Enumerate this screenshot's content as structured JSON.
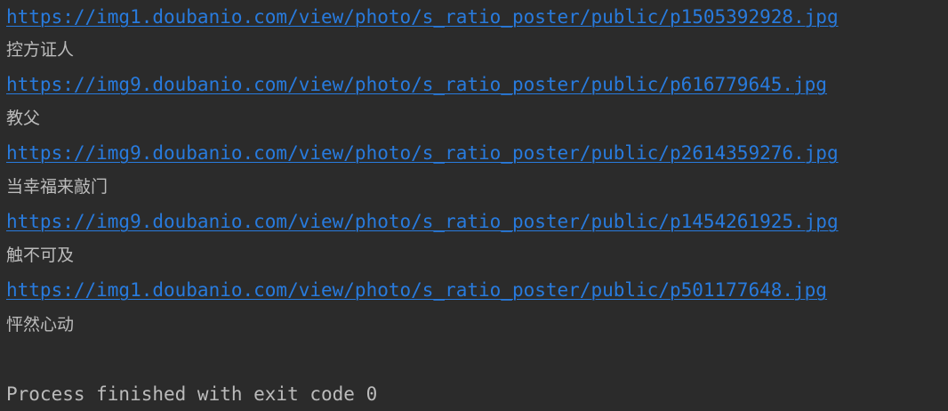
{
  "console": {
    "entries": [
      {
        "url": "https://img1.doubanio.com/view/photo/s_ratio_poster/public/p1505392928.jpg",
        "title": "控方证人"
      },
      {
        "url": "https://img9.doubanio.com/view/photo/s_ratio_poster/public/p616779645.jpg",
        "title": "教父"
      },
      {
        "url": "https://img9.doubanio.com/view/photo/s_ratio_poster/public/p2614359276.jpg",
        "title": "当幸福来敲门"
      },
      {
        "url": "https://img9.doubanio.com/view/photo/s_ratio_poster/public/p1454261925.jpg",
        "title": "触不可及"
      },
      {
        "url": "https://img1.doubanio.com/view/photo/s_ratio_poster/public/p501177648.jpg",
        "title": "怦然心动"
      }
    ],
    "exit_message": "Process finished with exit code 0"
  },
  "colors": {
    "background": "#2b2b2b",
    "link": "#287bde",
    "text": "#bbbbbb"
  }
}
